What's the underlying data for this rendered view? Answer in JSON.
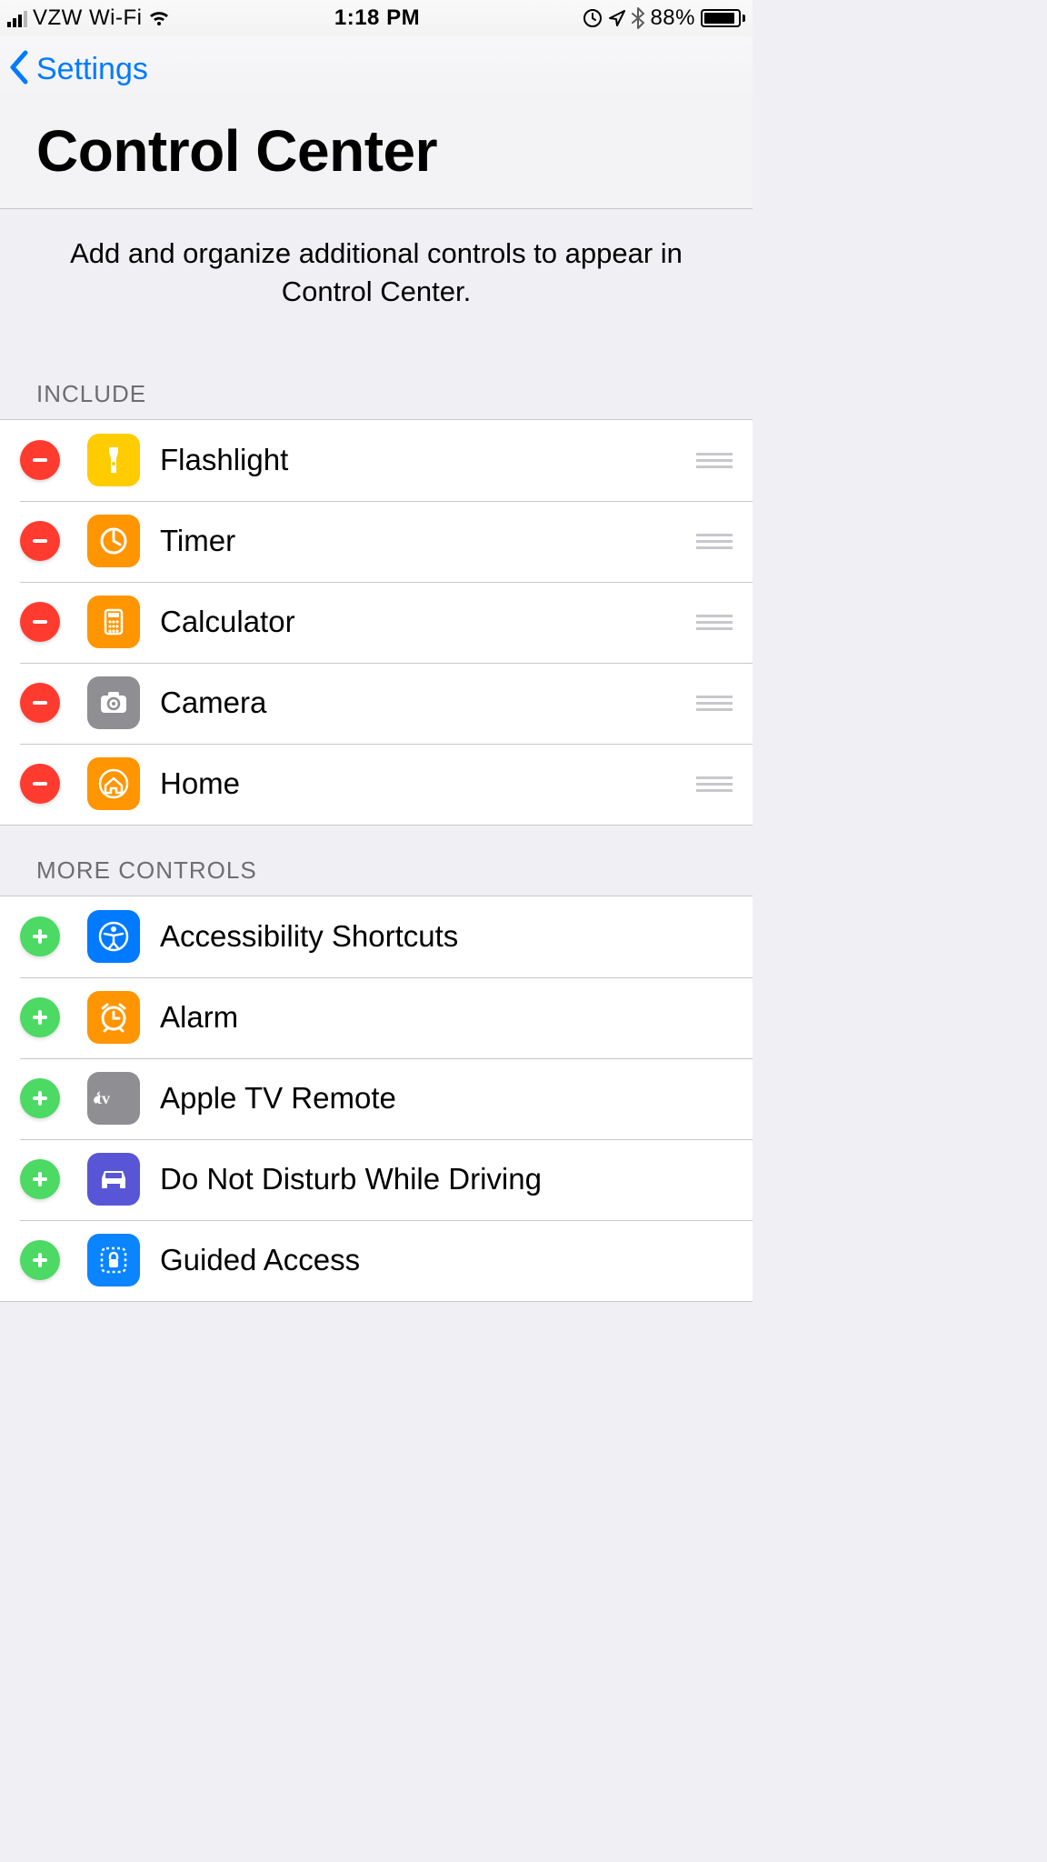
{
  "status_bar": {
    "carrier": "VZW Wi-Fi",
    "time": "1:18 PM",
    "battery_pct": "88%"
  },
  "nav": {
    "back_label": "Settings"
  },
  "title": "Control Center",
  "intro": "Add and organize additional controls to appear in Control Center.",
  "sections": {
    "include": {
      "header": "INCLUDE",
      "items": [
        {
          "label": "Flashlight",
          "icon": "flashlight",
          "icon_bg": "bg-yellow"
        },
        {
          "label": "Timer",
          "icon": "timer",
          "icon_bg": "bg-orange"
        },
        {
          "label": "Calculator",
          "icon": "calculator",
          "icon_bg": "bg-orange"
        },
        {
          "label": "Camera",
          "icon": "camera",
          "icon_bg": "bg-gray"
        },
        {
          "label": "Home",
          "icon": "home",
          "icon_bg": "bg-orange"
        }
      ]
    },
    "more": {
      "header": "MORE CONTROLS",
      "items": [
        {
          "label": "Accessibility Shortcuts",
          "icon": "accessibility",
          "icon_bg": "bg-blue"
        },
        {
          "label": "Alarm",
          "icon": "alarm",
          "icon_bg": "bg-orange"
        },
        {
          "label": "Apple TV Remote",
          "icon": "appletv",
          "icon_bg": "bg-gray"
        },
        {
          "label": "Do Not Disturb While Driving",
          "icon": "car",
          "icon_bg": "bg-purple"
        },
        {
          "label": "Guided Access",
          "icon": "guided",
          "icon_bg": "bg-blue2"
        }
      ]
    }
  }
}
